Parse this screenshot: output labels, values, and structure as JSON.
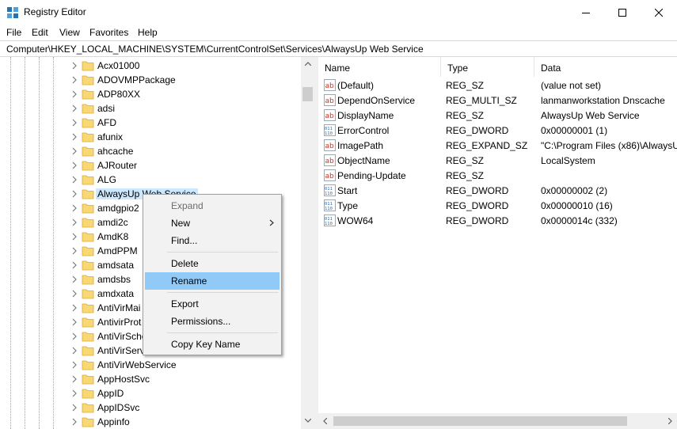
{
  "window": {
    "title": "Registry Editor",
    "app_icon": "registry-editor-icon"
  },
  "menu": [
    "File",
    "Edit",
    "View",
    "Favorites",
    "Help"
  ],
  "address": "Computer\\HKEY_LOCAL_MACHINE\\SYSTEM\\CurrentControlSet\\Services\\AlwaysUp Web Service",
  "tree": {
    "items": [
      "Acx01000",
      "ADOVMPPackage",
      "ADP80XX",
      "adsi",
      "AFD",
      "afunix",
      "ahcache",
      "AJRouter",
      "ALG",
      "AlwaysUp Web Service",
      "amdgpio2",
      "amdi2c",
      "AmdK8",
      "AmdPPM",
      "amdsata",
      "amdsbs",
      "amdxata",
      "AntiVirMai",
      "AntivirProt",
      "AntiVirSche",
      "AntiVirServ",
      "AntiVirWebService",
      "AppHostSvc",
      "AppID",
      "AppIDSvc",
      "Appinfo"
    ],
    "selected": "AlwaysUp Web Service"
  },
  "list": {
    "columns": [
      "Name",
      "Type",
      "Data"
    ],
    "rows": [
      {
        "name": "(Default)",
        "type": "REG_SZ",
        "data": "(value not set)",
        "icon": "string-value-icon"
      },
      {
        "name": "DependOnService",
        "type": "REG_MULTI_SZ",
        "data": "lanmanworkstation Dnscache",
        "icon": "string-value-icon"
      },
      {
        "name": "DisplayName",
        "type": "REG_SZ",
        "data": "AlwaysUp Web Service",
        "icon": "string-value-icon"
      },
      {
        "name": "ErrorControl",
        "type": "REG_DWORD",
        "data": "0x00000001 (1)",
        "icon": "binary-value-icon"
      },
      {
        "name": "ImagePath",
        "type": "REG_EXPAND_SZ",
        "data": "\"C:\\Program Files (x86)\\AlwaysU",
        "icon": "string-value-icon"
      },
      {
        "name": "ObjectName",
        "type": "REG_SZ",
        "data": "LocalSystem",
        "icon": "string-value-icon"
      },
      {
        "name": "Pending-Update",
        "type": "REG_SZ",
        "data": "",
        "icon": "string-value-icon"
      },
      {
        "name": "Start",
        "type": "REG_DWORD",
        "data": "0x00000002 (2)",
        "icon": "binary-value-icon"
      },
      {
        "name": "Type",
        "type": "REG_DWORD",
        "data": "0x00000010 (16)",
        "icon": "binary-value-icon"
      },
      {
        "name": "WOW64",
        "type": "REG_DWORD",
        "data": "0x0000014c (332)",
        "icon": "binary-value-icon"
      }
    ]
  },
  "context_menu": {
    "items": [
      {
        "label": "Expand",
        "disabled": true
      },
      {
        "label": "New",
        "submenu": true
      },
      {
        "label": "Find..."
      },
      {
        "separator": true
      },
      {
        "label": "Delete"
      },
      {
        "label": "Rename",
        "highlighted": true
      },
      {
        "separator": true
      },
      {
        "label": "Export"
      },
      {
        "label": "Permissions..."
      },
      {
        "separator": true
      },
      {
        "label": "Copy Key Name"
      }
    ]
  },
  "colors": {
    "selection": "#cce8ff",
    "menu_highlight": "#91c9f7",
    "folder": "#f8d775",
    "string_icon": "#c0392b",
    "binary_icon": "#2b6cb0"
  }
}
